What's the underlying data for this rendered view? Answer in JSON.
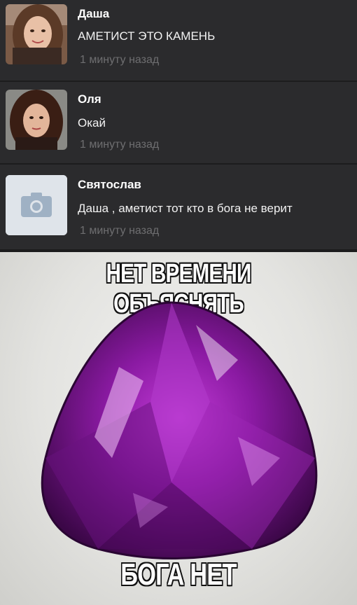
{
  "comments": [
    {
      "author": "Даша",
      "text": "АМЕТИСТ ЭТО КАМЕНЬ",
      "time": "1 минуту назад",
      "avatar": "user-photo"
    },
    {
      "author": "Оля",
      "text": "Окай",
      "time": "1 минуту назад",
      "avatar": "user-photo"
    },
    {
      "author": "Святослав",
      "text": "Даша , аметист тот кто в бога не верит",
      "time": "1 минуту назад",
      "avatar": "camera-icon"
    }
  ],
  "meme": {
    "top_text": "НЕТ ВРЕМЕНИ ОБЪЯСНЯТЬ",
    "bottom_text": "БОГА НЕТ",
    "image": "amethyst-gem"
  },
  "colors": {
    "background": "#2b2b2d",
    "author": "#ffffff",
    "text": "#f2f2f2",
    "time": "#6e6e70",
    "gem": "#9b1fb0"
  }
}
